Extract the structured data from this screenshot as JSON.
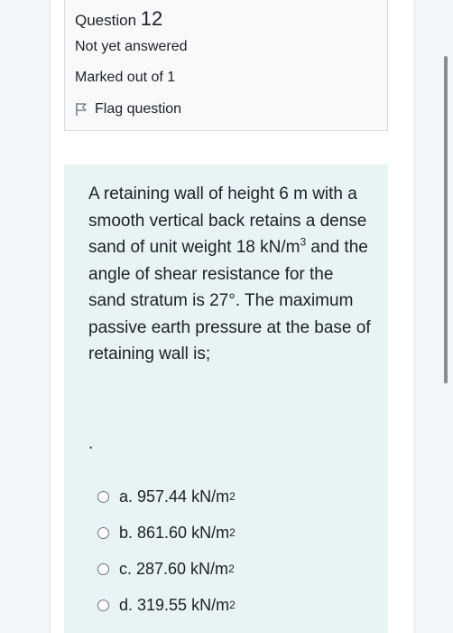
{
  "info": {
    "question_label": "Question",
    "question_number": "12",
    "state": "Not yet answered",
    "grade": "Marked out of 1",
    "flag_label": "Flag question",
    "flag_icon": "flag-icon"
  },
  "question": {
    "text_before_unit": "A retaining wall of height 6 m with a smooth vertical back retains a dense sand of unit weight 18 kN/m",
    "unit_exponent": "3",
    "text_after_unit": " and the angle of shear resistance for the sand stratum is 27°. The maximum passive earth pressure at the base of retaining wall is;",
    "trailing_dot": "."
  },
  "answers": [
    {
      "label": "a. 957.44 kN/m",
      "exponent": "2"
    },
    {
      "label": "b. 861.60 kN/m",
      "exponent": "2"
    },
    {
      "label": "c. 287.60 kN/m",
      "exponent": "2"
    },
    {
      "label": "d. 319.55 kN/m",
      "exponent": "2"
    }
  ],
  "colors": {
    "page_background": "#f1f6f9",
    "content_background": "#e7f3f5",
    "info_background": "#f8f9fa",
    "text": "#1d2125"
  }
}
